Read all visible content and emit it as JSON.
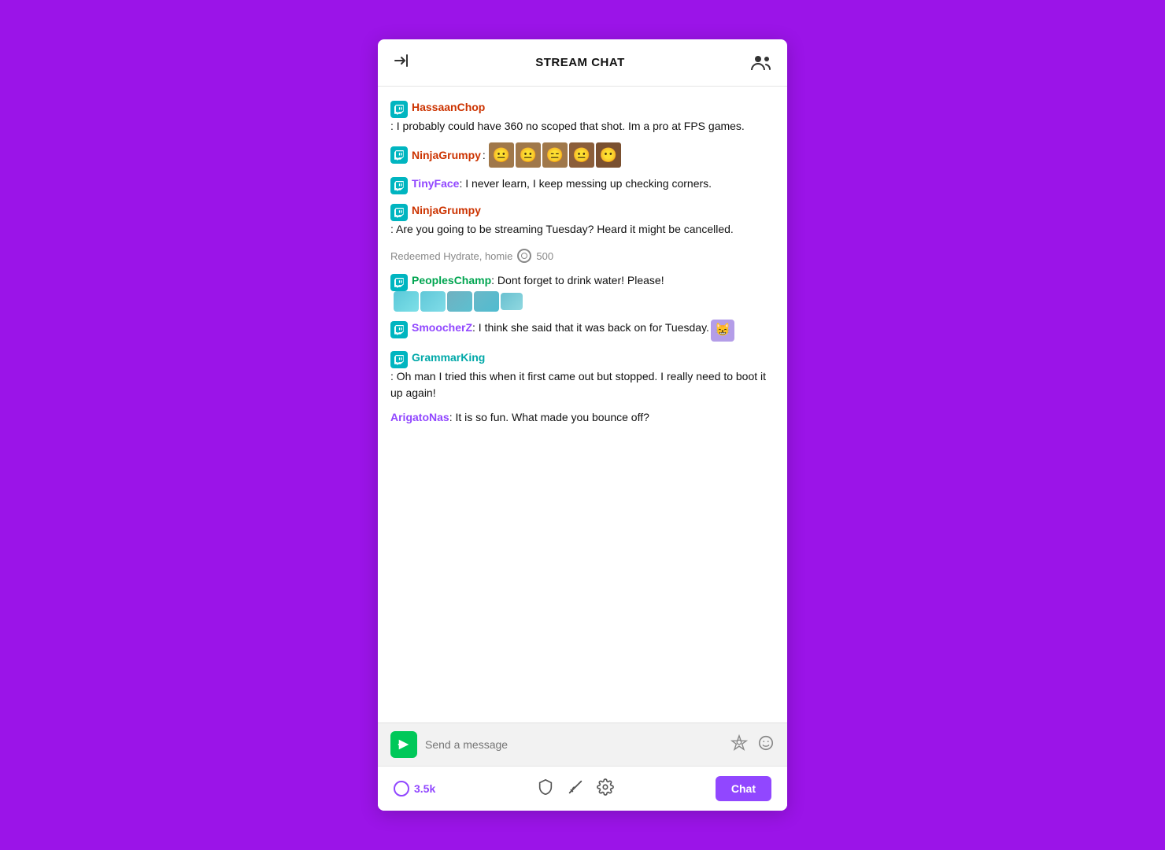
{
  "header": {
    "title": "STREAM CHAT",
    "collapse_icon": "↦",
    "users_icon": "👥"
  },
  "messages": [
    {
      "id": "msg1",
      "badge": true,
      "username": "HassaanChop",
      "username_color": "red",
      "text": ": I probably could have 360 no scoped that shot. Im a pro at FPS games.",
      "has_emotes": false
    },
    {
      "id": "msg2",
      "badge": true,
      "username": "NinjaGrumpy",
      "username_color": "red",
      "text": ":",
      "has_emotes": true,
      "emote_type": "faces"
    },
    {
      "id": "msg3",
      "badge": true,
      "username": "TinyFace",
      "username_color": "purple",
      "text": ": I never learn, I keep messing up checking corners.",
      "has_emotes": false
    },
    {
      "id": "msg4",
      "badge": true,
      "username": "NinjaGrumpy",
      "username_color": "red",
      "text": ": Are you going to be streaming Tuesday? Heard it might be cancelled.",
      "has_emotes": false
    }
  ],
  "redemption": {
    "text": "Redeemed Hydrate, homie",
    "points": "500"
  },
  "messages2": [
    {
      "id": "msg5",
      "badge": true,
      "username": "PeoplesChamp",
      "username_color": "green",
      "text": ": Dont forget to drink water! Please!",
      "has_emotes": true,
      "emote_type": "hydrate"
    },
    {
      "id": "msg6",
      "badge": true,
      "username": "SmoocherZ",
      "username_color": "purple",
      "text": ": I think she said that it was back on for Tuesday.",
      "has_emotes": true,
      "emote_type": "cat"
    },
    {
      "id": "msg7",
      "badge": true,
      "username": "GrammarKing",
      "username_color": "teal",
      "text": ": Oh man I tried this when it first came out but stopped. I really need to boot it up again!",
      "has_emotes": false
    },
    {
      "id": "msg8",
      "badge": false,
      "username": "ArigatoNas",
      "username_color": "purple",
      "text": ": It is so fun. What made you bounce off?",
      "has_emotes": false
    }
  ],
  "input": {
    "placeholder": "Send a message"
  },
  "footer": {
    "viewer_count": "3.5k",
    "chat_button_label": "Chat"
  }
}
